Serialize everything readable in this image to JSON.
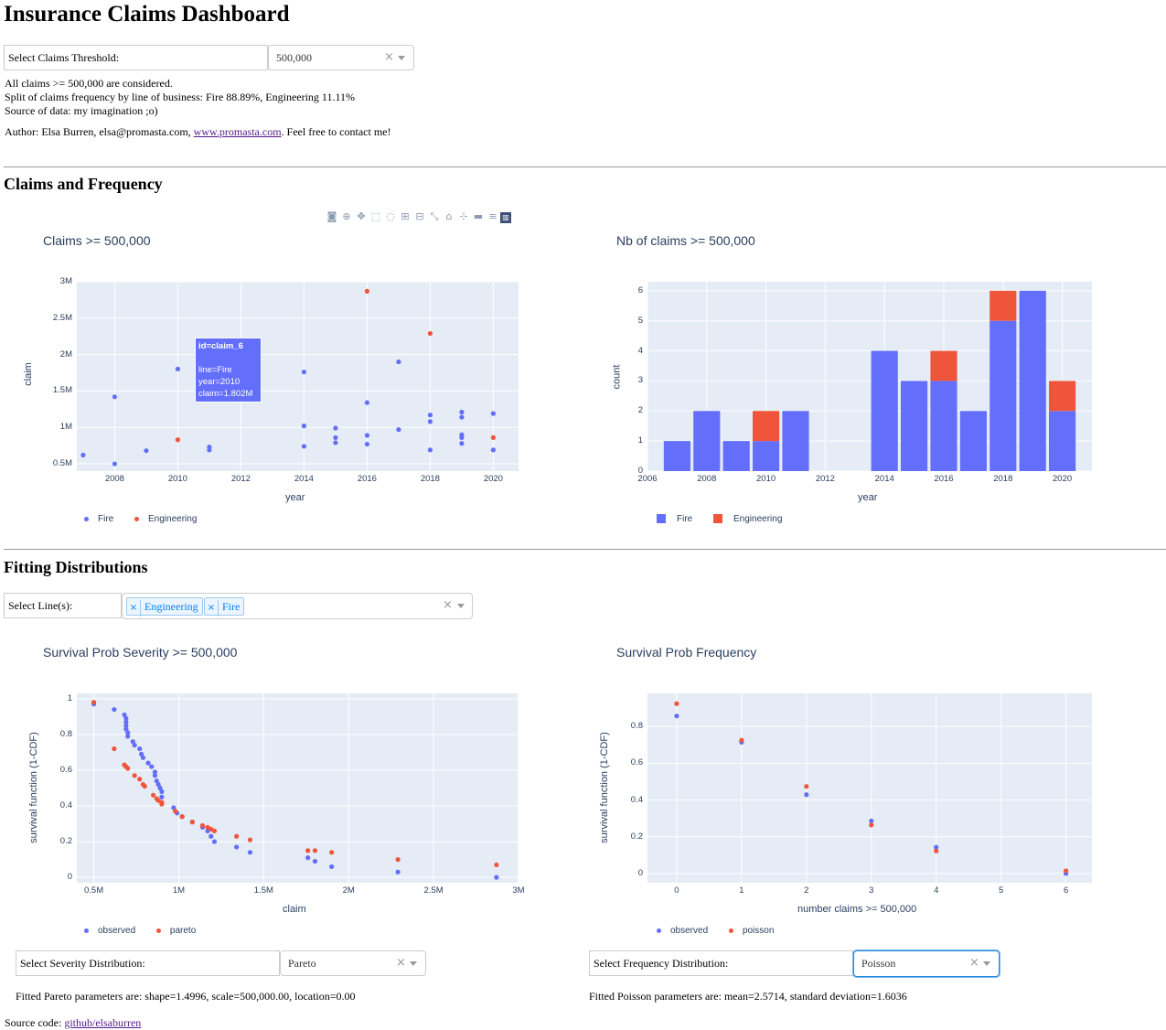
{
  "header": {
    "title": "Insurance Claims Dashboard"
  },
  "threshold": {
    "label": "Select Claims Threshold:",
    "value": "500,000",
    "info_line1": "All claims >= 500,000 are considered.",
    "info_line2": "Split of claims frequency by line of business: Fire 88.89%, Engineering 11.11%",
    "info_line3": "Source of data: my imagination ;o)"
  },
  "author": {
    "prefix": "Author: Elsa Burren, elsa@promasta.com, ",
    "link": "www.promasta.com",
    "suffix": ". Feel free to contact me!"
  },
  "sections": {
    "claims": "Claims and Frequency",
    "fitting": "Fitting Distributions"
  },
  "toolbar_icons": [
    "camera-icon",
    "zoom-icon",
    "pan-icon",
    "box-select-icon",
    "lasso-icon",
    "zoom-in-icon",
    "zoom-out-icon",
    "autoscale-icon",
    "reset-axes-icon",
    "spike-lines-icon",
    "hover-closest-icon",
    "hover-compare-icon",
    "plotly-logo-icon"
  ],
  "colors": {
    "fire": "#636efa",
    "engineering": "#ef553b",
    "plot_bg": "#e5ecf6",
    "axis_text": "#2a3f5f"
  },
  "scatter_claims": {
    "title": "Claims >= 500,000",
    "xlabel": "year",
    "ylabel": "claim",
    "legend": [
      "Fire",
      "Engineering"
    ],
    "tooltip": {
      "id": "id=claim_6",
      "line": "line=Fire",
      "year": "year=2010",
      "claim": "claim=1.802M"
    }
  },
  "bar_count": {
    "title": "Nb of claims >= 500,000",
    "xlabel": "year",
    "ylabel": "count",
    "legend": [
      "Fire",
      "Engineering"
    ]
  },
  "lines": {
    "label": "Select Line(s):",
    "tags": [
      "Engineering",
      "Fire"
    ]
  },
  "survival_severity": {
    "title": "Survival Prob Severity >= 500,000",
    "xlabel": "claim",
    "ylabel": "survival function (1-CDF)",
    "legend": [
      "observed",
      "pareto"
    ]
  },
  "survival_frequency": {
    "title": "Survival Prob Frequency",
    "xlabel": "number claims >= 500,000",
    "ylabel": "survival function (1-CDF)",
    "legend": [
      "observed",
      "poisson"
    ]
  },
  "severity_select": {
    "label": "Select Severity Distribution:",
    "value": "Pareto",
    "fitted": "Fitted Pareto parameters are: shape=1.4996, scale=500,000.00, location=0.00"
  },
  "frequency_select": {
    "label": "Select Frequency Distribution:",
    "value": "Poisson",
    "fitted": "Fitted Poisson parameters are: mean=2.5714, standard deviation=1.6036"
  },
  "footer": {
    "prefix": "Source code: ",
    "link": "github/elsaburren"
  },
  "chart_data": [
    {
      "type": "scatter",
      "title": "Claims >= 500,000",
      "xlabel": "year",
      "ylabel": "claim",
      "xlim": [
        2006.8,
        2020.8
      ],
      "ylim": [
        400000,
        3000000
      ],
      "xticks": [
        2008,
        2010,
        2012,
        2014,
        2016,
        2018,
        2020
      ],
      "yticks": [
        500000,
        1000000,
        1500000,
        2000000,
        2500000,
        3000000
      ],
      "ytick_labels": [
        "0.5M",
        "1M",
        "1.5M",
        "2M",
        "2.5M",
        "3M"
      ],
      "series": [
        {
          "name": "Fire",
          "points": [
            [
              2007,
              620000
            ],
            [
              2008,
              1420000
            ],
            [
              2008,
              500000
            ],
            [
              2009,
              680000
            ],
            [
              2010,
              1802000
            ],
            [
              2011,
              730000
            ],
            [
              2011,
              690000
            ],
            [
              2014,
              1760000
            ],
            [
              2014,
              1020000
            ],
            [
              2014,
              740000
            ],
            [
              2015,
              990000
            ],
            [
              2015,
              860000
            ],
            [
              2015,
              790000
            ],
            [
              2016,
              1340000
            ],
            [
              2016,
              890000
            ],
            [
              2016,
              770000
            ],
            [
              2017,
              1900000
            ],
            [
              2017,
              970000
            ],
            [
              2018,
              1170000
            ],
            [
              2018,
              1080000
            ],
            [
              2018,
              690000
            ],
            [
              2019,
              1210000
            ],
            [
              2019,
              1140000
            ],
            [
              2019,
              900000
            ],
            [
              2019,
              860000
            ],
            [
              2019,
              780000
            ],
            [
              2020,
              1190000
            ],
            [
              2020,
              690000
            ]
          ]
        },
        {
          "name": "Engineering",
          "points": [
            [
              2010,
              830000
            ],
            [
              2016,
              2870000
            ],
            [
              2018,
              2290000
            ],
            [
              2020,
              860000
            ]
          ]
        }
      ]
    },
    {
      "type": "bar",
      "title": "Nb of claims >= 500,000",
      "xlabel": "year",
      "ylabel": "count",
      "xlim": [
        2006,
        2021
      ],
      "ylim": [
        0,
        6.3
      ],
      "xticks": [
        2006,
        2008,
        2010,
        2012,
        2014,
        2016,
        2018,
        2020
      ],
      "yticks": [
        0,
        1,
        2,
        3,
        4,
        5,
        6
      ],
      "categories": [
        2007,
        2008,
        2009,
        2010,
        2011,
        2014,
        2015,
        2016,
        2017,
        2018,
        2019,
        2020
      ],
      "series": [
        {
          "name": "Fire",
          "values": [
            1,
            2,
            1,
            1,
            2,
            4,
            3,
            3,
            2,
            5,
            6,
            2
          ]
        },
        {
          "name": "Engineering",
          "values": [
            0,
            0,
            0,
            1,
            0,
            0,
            0,
            1,
            0,
            1,
            0,
            1
          ]
        }
      ],
      "barmode": "stack"
    },
    {
      "type": "scatter",
      "title": "Survival Prob Severity >= 500,000",
      "xlabel": "claim",
      "ylabel": "survival function (1-CDF)",
      "xlim": [
        400000,
        3000000
      ],
      "ylim": [
        -0.03,
        1.03
      ],
      "xticks": [
        500000,
        1000000,
        1500000,
        2000000,
        2500000,
        3000000
      ],
      "xtick_labels": [
        "0.5M",
        "1M",
        "1.5M",
        "2M",
        "2.5M",
        "3M"
      ],
      "yticks": [
        0,
        0.2,
        0.4,
        0.6,
        0.8,
        1
      ],
      "series": [
        {
          "name": "observed",
          "points": [
            [
              500000,
              0.97
            ],
            [
              620000,
              0.94
            ],
            [
              680000,
              0.91
            ],
            [
              690000,
              0.89
            ],
            [
              690000,
              0.87
            ],
            [
              690000,
              0.85
            ],
            [
              690000,
              0.83
            ],
            [
              700000,
              0.81
            ],
            [
              700000,
              0.79
            ],
            [
              730000,
              0.76
            ],
            [
              740000,
              0.74
            ],
            [
              770000,
              0.72
            ],
            [
              780000,
              0.69
            ],
            [
              790000,
              0.67
            ],
            [
              820000,
              0.64
            ],
            [
              840000,
              0.62
            ],
            [
              860000,
              0.59
            ],
            [
              860000,
              0.57
            ],
            [
              870000,
              0.54
            ],
            [
              880000,
              0.52
            ],
            [
              890000,
              0.5
            ],
            [
              900000,
              0.48
            ],
            [
              900000,
              0.45
            ],
            [
              970000,
              0.39
            ],
            [
              990000,
              0.36
            ],
            [
              1020000,
              0.34
            ],
            [
              1080000,
              0.31
            ],
            [
              1140000,
              0.28
            ],
            [
              1170000,
              0.26
            ],
            [
              1190000,
              0.23
            ],
            [
              1210000,
              0.2
            ],
            [
              1340000,
              0.17
            ],
            [
              1420000,
              0.14
            ],
            [
              1760000,
              0.11
            ],
            [
              1802000,
              0.09
            ],
            [
              1900000,
              0.06
            ],
            [
              2290000,
              0.03
            ],
            [
              2870000,
              0.0
            ]
          ]
        },
        {
          "name": "pareto",
          "points": [
            [
              500000,
              0.98
            ],
            [
              620000,
              0.72
            ],
            [
              680000,
              0.63
            ],
            [
              690000,
              0.62
            ],
            [
              700000,
              0.61
            ],
            [
              740000,
              0.57
            ],
            [
              770000,
              0.55
            ],
            [
              790000,
              0.52
            ],
            [
              800000,
              0.51
            ],
            [
              850000,
              0.46
            ],
            [
              870000,
              0.44
            ],
            [
              880000,
              0.43
            ],
            [
              900000,
              0.42
            ],
            [
              900000,
              0.41
            ],
            [
              980000,
              0.37
            ],
            [
              1020000,
              0.34
            ],
            [
              1080000,
              0.31
            ],
            [
              1140000,
              0.29
            ],
            [
              1170000,
              0.28
            ],
            [
              1190000,
              0.27
            ],
            [
              1210000,
              0.26
            ],
            [
              1340000,
              0.23
            ],
            [
              1420000,
              0.21
            ],
            [
              1760000,
              0.15
            ],
            [
              1802000,
              0.15
            ],
            [
              1900000,
              0.14
            ],
            [
              2290000,
              0.1
            ],
            [
              2870000,
              0.07
            ]
          ]
        }
      ]
    },
    {
      "type": "scatter",
      "title": "Survival Prob Frequency",
      "xlabel": "number claims >= 500,000",
      "ylabel": "survival function (1-CDF)",
      "xlim": [
        -0.45,
        6.4
      ],
      "ylim": [
        -0.05,
        0.98
      ],
      "xticks": [
        0,
        1,
        2,
        3,
        4,
        5,
        6
      ],
      "yticks": [
        0,
        0.2,
        0.4,
        0.6,
        0.8
      ],
      "series": [
        {
          "name": "observed",
          "points": [
            [
              0,
              0.857
            ],
            [
              1,
              0.714
            ],
            [
              2,
              0.429
            ],
            [
              3,
              0.286
            ],
            [
              4,
              0.143
            ],
            [
              6,
              0.0
            ]
          ]
        },
        {
          "name": "poisson",
          "points": [
            [
              0,
              0.924
            ],
            [
              1,
              0.725
            ],
            [
              2,
              0.474
            ],
            [
              3,
              0.264
            ],
            [
              4,
              0.123
            ],
            [
              6,
              0.015
            ]
          ]
        }
      ]
    }
  ]
}
